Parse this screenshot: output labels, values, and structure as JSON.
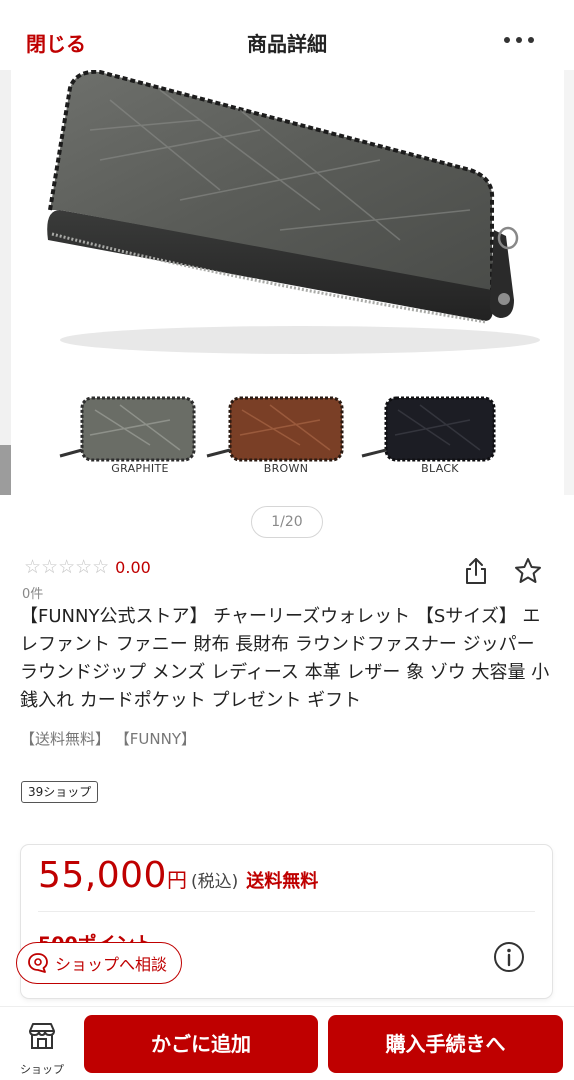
{
  "header": {
    "close_label": "閉じる",
    "title": "商品詳細",
    "more_icon": "more-horizontal-icon"
  },
  "gallery": {
    "counter": "1/20",
    "variants": [
      {
        "label": "GRAPHITE",
        "color": "#6a6d66"
      },
      {
        "label": "BROWN",
        "color": "#7a3f26"
      },
      {
        "label": "BLACK",
        "color": "#1c1d24"
      }
    ],
    "main_color": "#595b58"
  },
  "product": {
    "rating_stars": "☆☆☆☆☆",
    "rating_score": "0.00",
    "review_count": "0件",
    "title": "【FUNNY公式ストア】 チャーリーズウォレット 【Sサイズ】 エレファント ファニー 財布 長財布 ラウンドファスナー ジッパー ラウンドジップ メンズ レディース 本革 レザー 象 ゾウ 大容量 小銭入れ カードポケット プレゼント ギフト",
    "tags": "【送料無料】 【FUNNY】",
    "shop_badge": "39ショップ"
  },
  "price": {
    "value": "55,000",
    "yen": "円",
    "tax": "(税込)",
    "shipping": "送料無料",
    "points": "500ポイント"
  },
  "chat": {
    "label": "ショップへ相談"
  },
  "bottom_bar": {
    "shop_label": "ショップ",
    "cart_label": "かごに追加",
    "buy_label": "購入手続きへ"
  },
  "colors": {
    "accent": "#bf0000"
  }
}
